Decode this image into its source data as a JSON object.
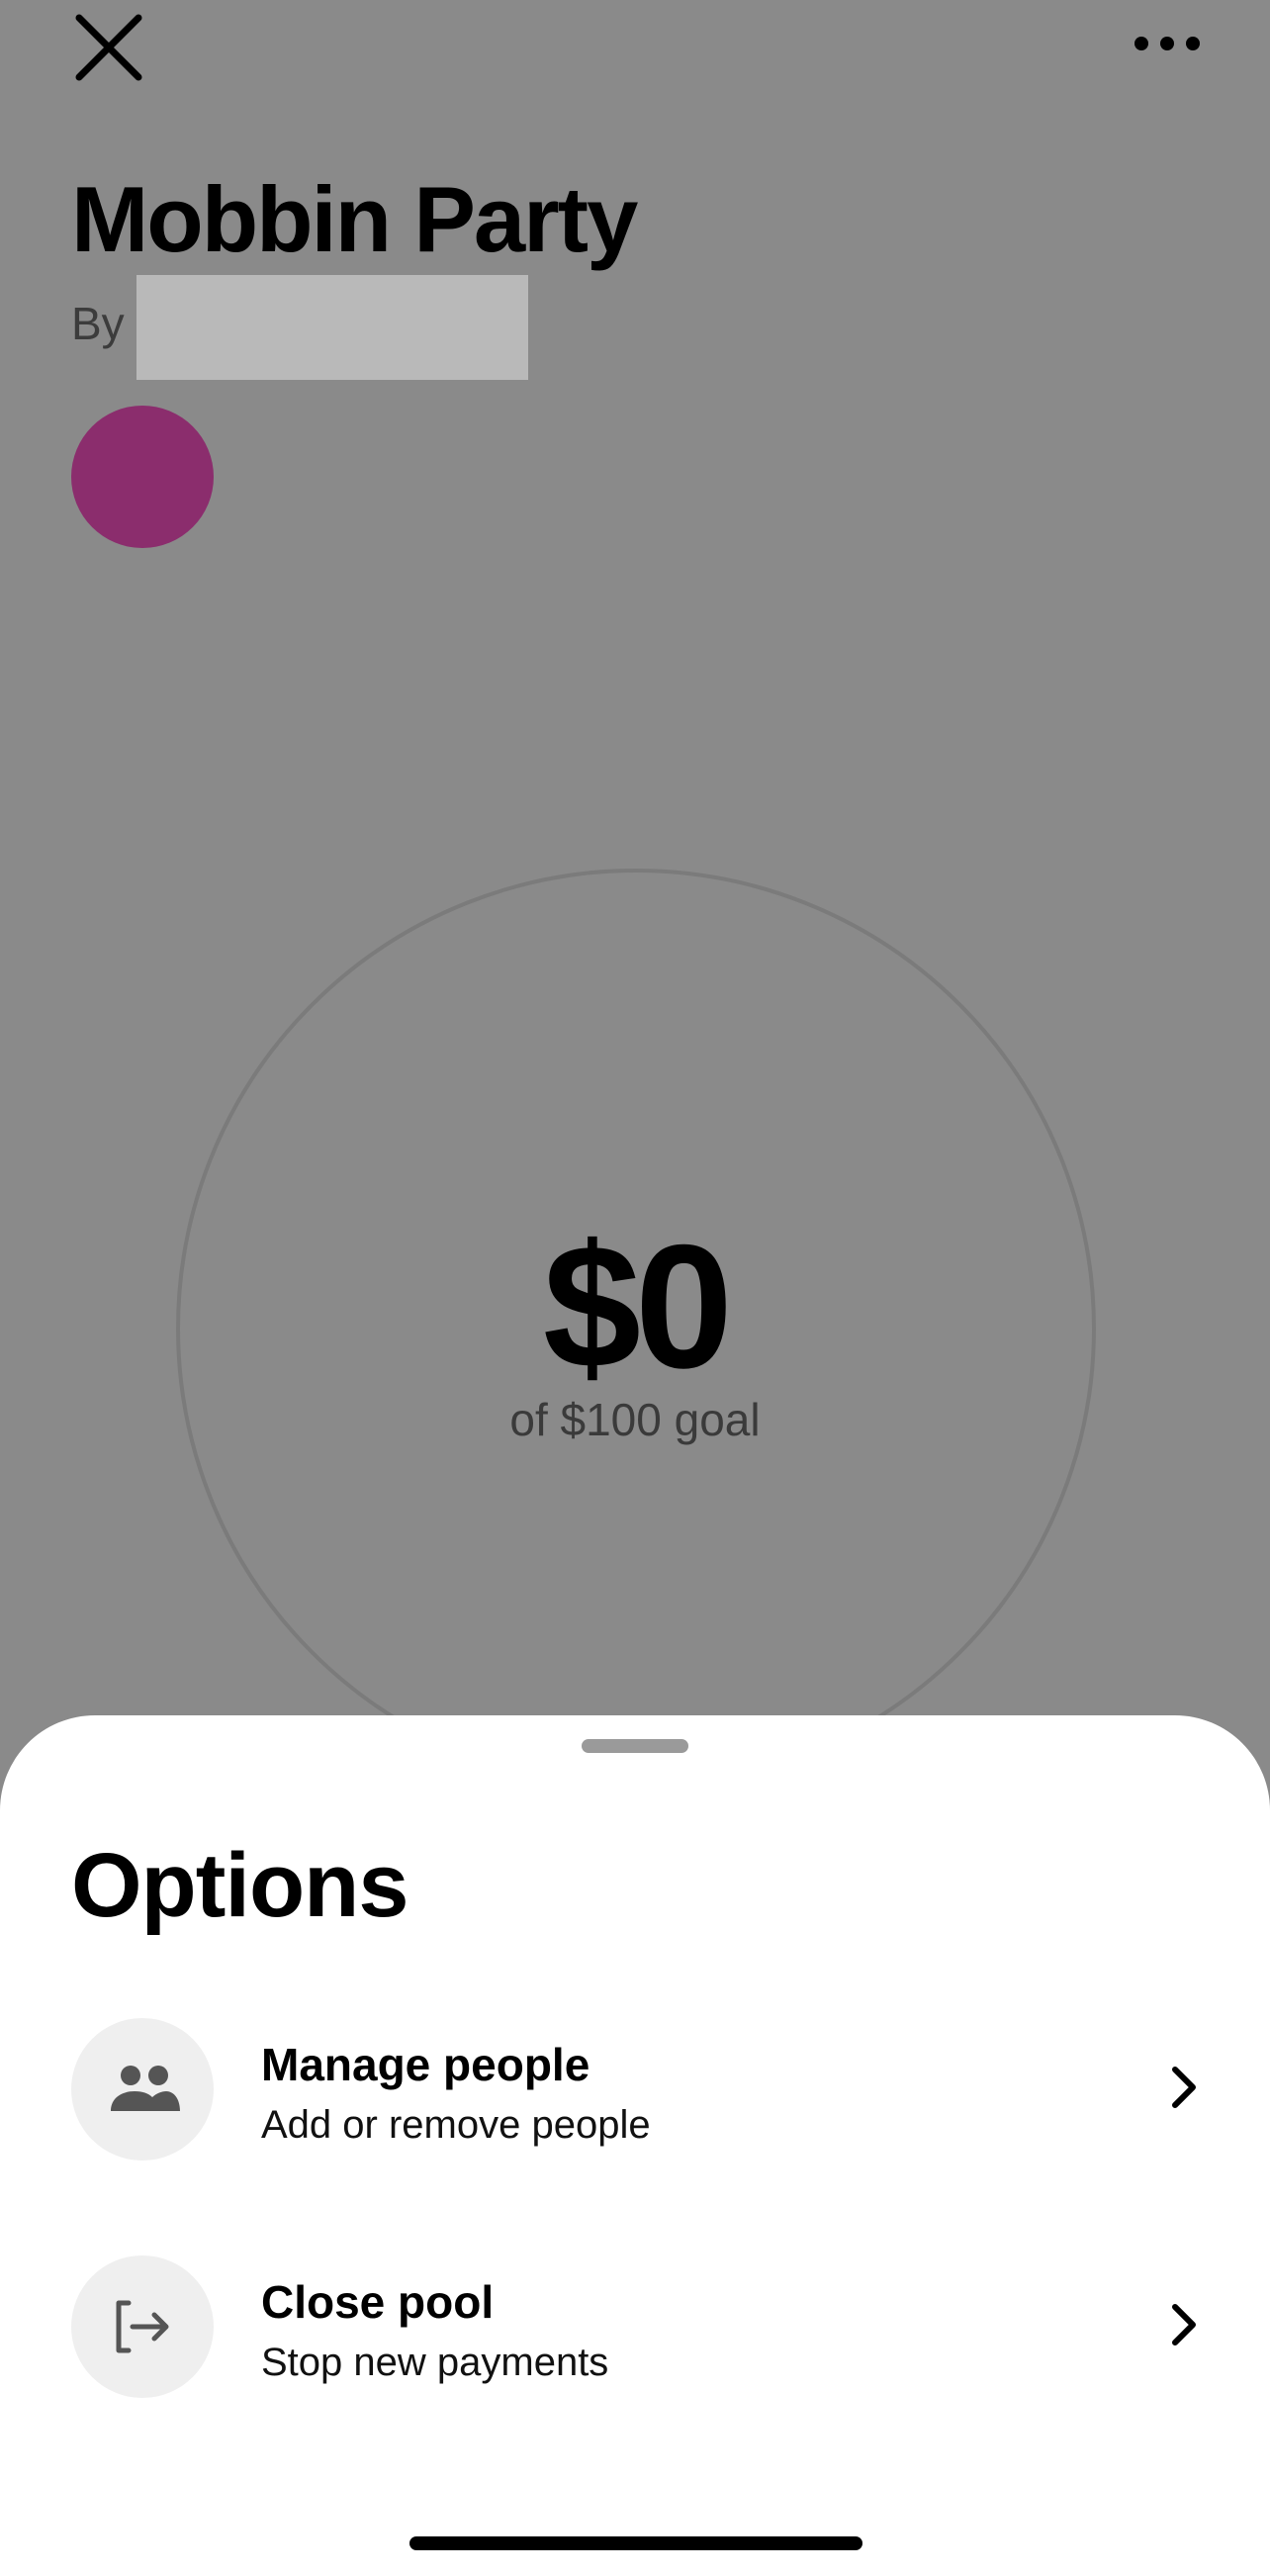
{
  "header": {
    "close_icon": "close-icon",
    "more_icon": "more-horizontal-icon"
  },
  "pool": {
    "title": "Mobbin Party",
    "by_label": "By",
    "avatar_color": "#8b2d6d",
    "amount": "$0",
    "goal_text": "of $100 goal"
  },
  "sheet": {
    "title": "Options",
    "options": [
      {
        "title": "Manage people",
        "subtitle": "Add or remove people",
        "icon": "people-icon"
      },
      {
        "title": "Close pool",
        "subtitle": "Stop new payments",
        "icon": "exit-icon"
      }
    ]
  },
  "colors": {
    "overlay": "#8a8a8a",
    "sheet": "#ffffff",
    "icon_bg": "#efefef"
  }
}
